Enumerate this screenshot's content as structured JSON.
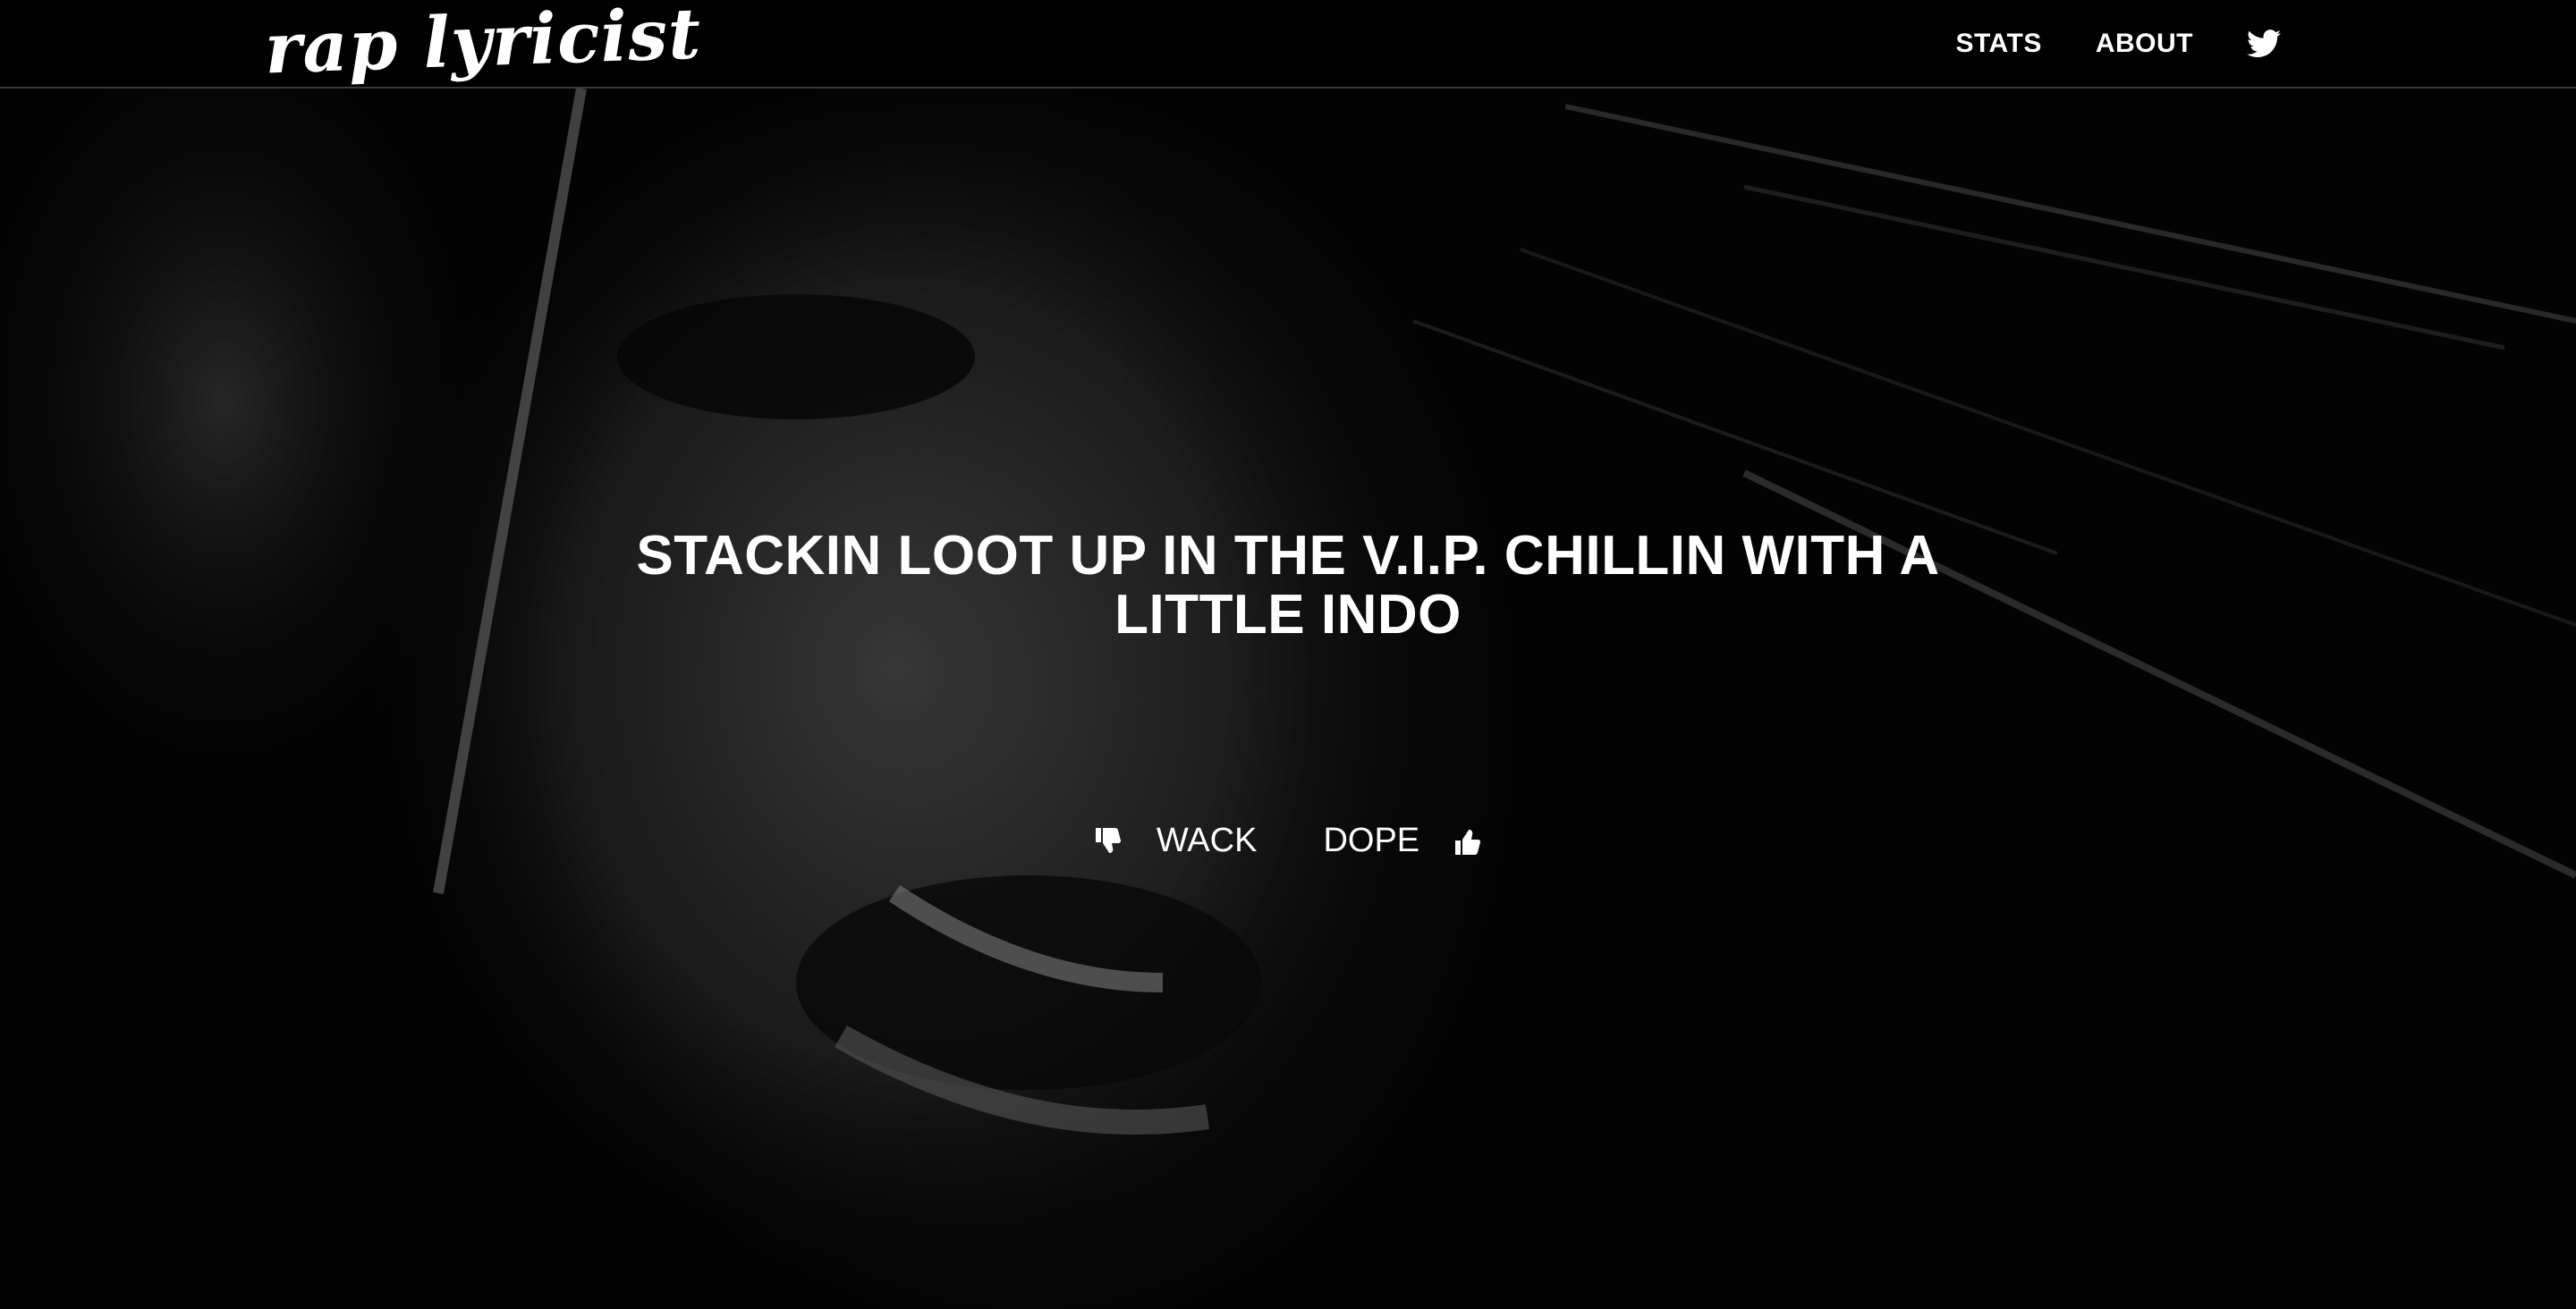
{
  "navbar": {
    "brand": "rap lyricist",
    "links": [
      {
        "label": "STATS"
      },
      {
        "label": "ABOUT"
      }
    ],
    "twitter_icon": "twitter-icon"
  },
  "hero": {
    "lyric": "STACKIN LOOT UP IN THE V.I.P. CHILLIN WITH A LITTLE INDO",
    "wack_label": "WACK",
    "dope_label": "DOPE",
    "wack_icon": "thumbs-down-icon",
    "dope_icon": "thumbs-up-icon"
  },
  "colors": {
    "navbar_bg": "#000000",
    "text": "#ffffff",
    "navbar_border": "#3a3a3a"
  }
}
